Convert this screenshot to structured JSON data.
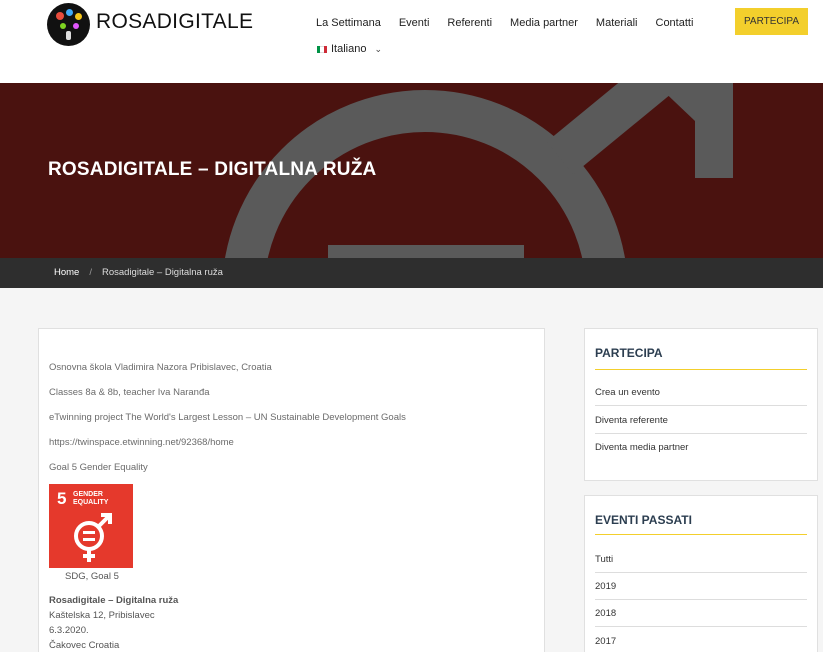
{
  "header": {
    "brand": "ROSADIGITALE",
    "nav": [
      "La Settimana",
      "Eventi",
      "Referenti",
      "Media partner",
      "Materiali",
      "Contatti"
    ],
    "language": "Italiano",
    "cta_label": "PARTECIPA"
  },
  "hero": {
    "title": "ROSADIGITALE – DIGITALNA RUŽA"
  },
  "breadcrumb": {
    "home": "Home",
    "separator": "/",
    "current": "Rosadigitale – Digitalna ruža"
  },
  "content": {
    "lines": [
      "Osnovna škola Vladimira Nazora Pribislavec, Croatia",
      "Classes 8a & 8b, teacher Iva Naranđa",
      "eTwinning project The World's Largest Lesson – UN Sustainable Development Goals",
      "https://twinspace.etwinning.net/92368/home",
      "Goal 5 Gender Equality"
    ],
    "sdg_number": "5",
    "sdg_label_1": "GENDER",
    "sdg_label_2": "EQUALITY",
    "caption": "SDG, Goal 5",
    "event_title": "Rosadigitale – Digitalna ruža",
    "event_address": "Kaštelska 12, Pribislavec",
    "event_date": "6.3.2020.",
    "event_city": "Čakovec Croatia"
  },
  "sidebar": {
    "partecipa": {
      "title": "PARTECIPA",
      "items": [
        "Crea un evento",
        "Diventa referente",
        "Diventa media partner"
      ]
    },
    "eventi": {
      "title": "EVENTI PASSATI",
      "items": [
        "Tutti",
        "2019",
        "2018",
        "2017"
      ]
    }
  },
  "colors": {
    "hero_bg": "#4a120f",
    "accent": "#f3cf2c",
    "sdg_red": "#e5392c",
    "crumb_bg": "#2e2e2e"
  }
}
